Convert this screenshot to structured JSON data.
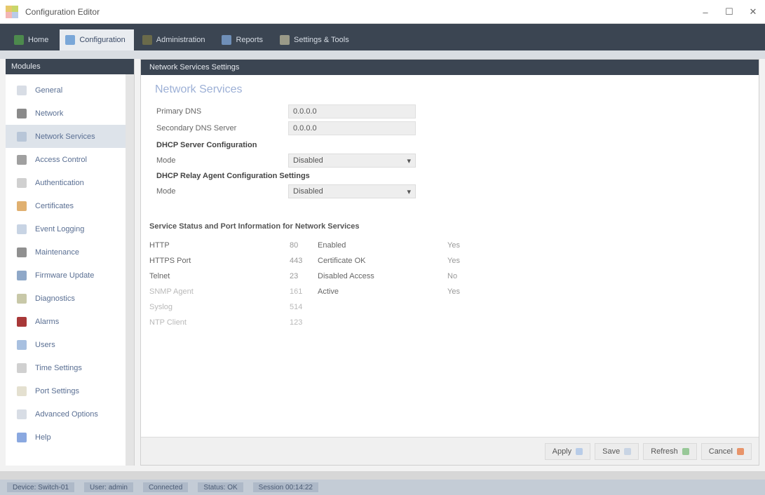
{
  "window": {
    "title": "Configuration Editor",
    "controls": [
      "–",
      "☐",
      "✕"
    ],
    "logo_colors": [
      "#e6c96b",
      "#c8d66a",
      "#f3b6b6",
      "#b9cbe8"
    ]
  },
  "tabs": [
    {
      "label": "Home",
      "color": "#4d8a4d",
      "active": false
    },
    {
      "label": "Configuration",
      "color": "#7aa7d8",
      "active": true
    },
    {
      "label": "Administration",
      "color": "#6a6a4a",
      "active": false
    },
    {
      "label": "Reports",
      "color": "#6f8fb8",
      "active": false
    },
    {
      "label": "Settings & Tools",
      "color": "#9a9a88",
      "active": false
    }
  ],
  "sidebar": {
    "header": "Modules",
    "items": [
      {
        "label": "General",
        "color": "#d8dde5"
      },
      {
        "label": "Network",
        "color": "#8a8a8a"
      },
      {
        "label": "Network Services",
        "color": "#b8c6d8",
        "active": true
      },
      {
        "label": "Access Control",
        "color": "#a0a0a0"
      },
      {
        "label": "Authentication",
        "color": "#d0d0d0"
      },
      {
        "label": "Certificates",
        "color": "#e0b070"
      },
      {
        "label": "Event Logging",
        "color": "#c8d4e4"
      },
      {
        "label": "Maintenance",
        "color": "#909090"
      },
      {
        "label": "Firmware Update",
        "color": "#8fa8c8"
      },
      {
        "label": "Diagnostics",
        "color": "#c8c8a8"
      },
      {
        "label": "Alarms",
        "color": "#a83838"
      },
      {
        "label": "Users",
        "color": "#a8c0e0"
      },
      {
        "label": "Time Settings",
        "color": "#d0d0d0"
      },
      {
        "label": "Port Settings",
        "color": "#e4e0d0"
      },
      {
        "label": "Advanced Options",
        "color": "#d8dde5"
      },
      {
        "label": "Help",
        "color": "#8aa8e0"
      }
    ]
  },
  "main": {
    "header": "Network Services Settings",
    "title": "Network Services",
    "fields": [
      {
        "label": "Primary DNS",
        "value": "0.0.0.0"
      },
      {
        "label": "Secondary DNS Server",
        "value": "0.0.0.0"
      }
    ],
    "section1": "DHCP Server Configuration",
    "select1": {
      "label": "Mode",
      "value": "Disabled"
    },
    "section2": "DHCP Relay Agent Configuration Settings",
    "select2": {
      "label": "Mode",
      "value": "Disabled"
    },
    "info": {
      "title": "Service Status and Port Information for Network Services",
      "rows": [
        [
          "HTTP",
          "80",
          "Enabled",
          "Yes"
        ],
        [
          "HTTPS Port",
          "443",
          "Certificate OK",
          "Yes"
        ],
        [
          "Telnet",
          "23",
          "Disabled Access",
          "No"
        ],
        [
          "SNMP Agent",
          "161",
          "Active",
          "Yes"
        ],
        [
          "Syslog",
          "514",
          "",
          ""
        ],
        [
          "NTP Client",
          "123",
          "",
          ""
        ]
      ]
    }
  },
  "footer_buttons": [
    {
      "label": "Apply",
      "color": "#b8cce8"
    },
    {
      "label": "Save",
      "color": "#c8d4e4"
    },
    {
      "label": "Refresh",
      "color": "#98c898"
    },
    {
      "label": "Cancel",
      "color": "#e8946a"
    }
  ],
  "taskbar": [
    "Device: Switch-01",
    "User: admin",
    "Connected",
    "Status: OK",
    "Session 00:14:22"
  ]
}
